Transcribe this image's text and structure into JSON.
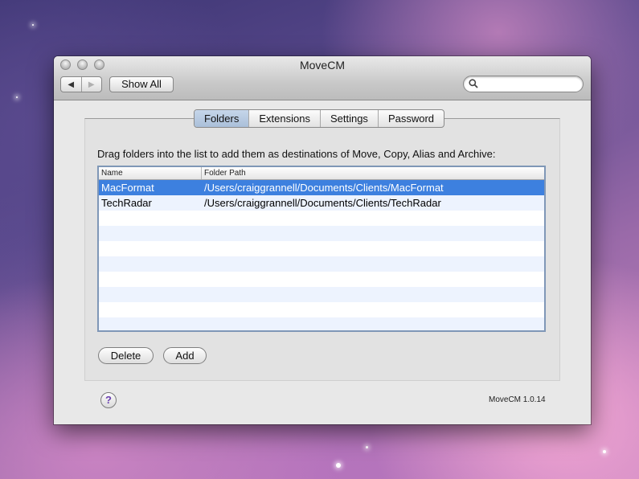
{
  "window": {
    "title": "MoveCM"
  },
  "toolbar": {
    "back_glyph": "◀",
    "forward_glyph": "▶",
    "show_all_label": "Show All",
    "search_icon": "search-icon",
    "search_value": ""
  },
  "tabs": [
    {
      "label": "Folders",
      "active": true
    },
    {
      "label": "Extensions",
      "active": false
    },
    {
      "label": "Settings",
      "active": false
    },
    {
      "label": "Password",
      "active": false
    }
  ],
  "instructions": "Drag folders into the list to add them as destinations of Move, Copy, Alias and Archive:",
  "table": {
    "columns": [
      "Name",
      "Folder Path"
    ],
    "rows": [
      {
        "name": "MacFormat",
        "path": "/Users/craiggrannell/Documents/Clients/MacFormat",
        "selected": true
      },
      {
        "name": "TechRadar",
        "path": "/Users/craiggrannell/Documents/Clients/TechRadar",
        "selected": false
      }
    ]
  },
  "buttons": {
    "delete_label": "Delete",
    "add_label": "Add"
  },
  "help_label": "?",
  "version": "MoveCM 1.0.14",
  "colors": {
    "selection": "#3d80df",
    "active_tab": "#aabfd9"
  }
}
